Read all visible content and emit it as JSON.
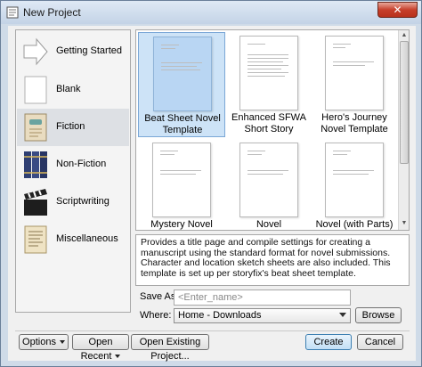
{
  "window": {
    "title": "New Project",
    "close_glyph": "✕"
  },
  "categories": [
    {
      "label": "Getting Started",
      "icon": "arrow-icon",
      "selected": false
    },
    {
      "label": "Blank",
      "icon": "blank-page-icon",
      "selected": false
    },
    {
      "label": "Fiction",
      "icon": "fiction-book-icon",
      "selected": true
    },
    {
      "label": "Non-Fiction",
      "icon": "books-icon",
      "selected": false
    },
    {
      "label": "Scriptwriting",
      "icon": "clapperboard-icon",
      "selected": false
    },
    {
      "label": "Miscellaneous",
      "icon": "scroll-page-icon",
      "selected": false
    }
  ],
  "templates": [
    {
      "label": "Beat Sheet Novel Template",
      "selected": true
    },
    {
      "label": "Enhanced SFWA Short Story",
      "selected": false
    },
    {
      "label": "Hero's Journey Novel Template",
      "selected": false
    },
    {
      "label": "Mystery Novel Template",
      "selected": false
    },
    {
      "label": "Novel",
      "selected": false
    },
    {
      "label": "Novel (with Parts)",
      "selected": false
    }
  ],
  "description": "Provides a title page and compile settings for creating a manuscript using the standard format for novel submissions. Character and location sketch sheets are also included. This template is set up per storyfix's beat sheet template.",
  "save_as": {
    "label": "Save As:",
    "placeholder": "<Enter_name>"
  },
  "where": {
    "label": "Where:",
    "value": "Home - Downloads"
  },
  "buttons": {
    "browse": "Browse",
    "options": "Options",
    "open_recent": "Open Recent",
    "open_existing": "Open Existing Project...",
    "create": "Create",
    "cancel": "Cancel"
  }
}
